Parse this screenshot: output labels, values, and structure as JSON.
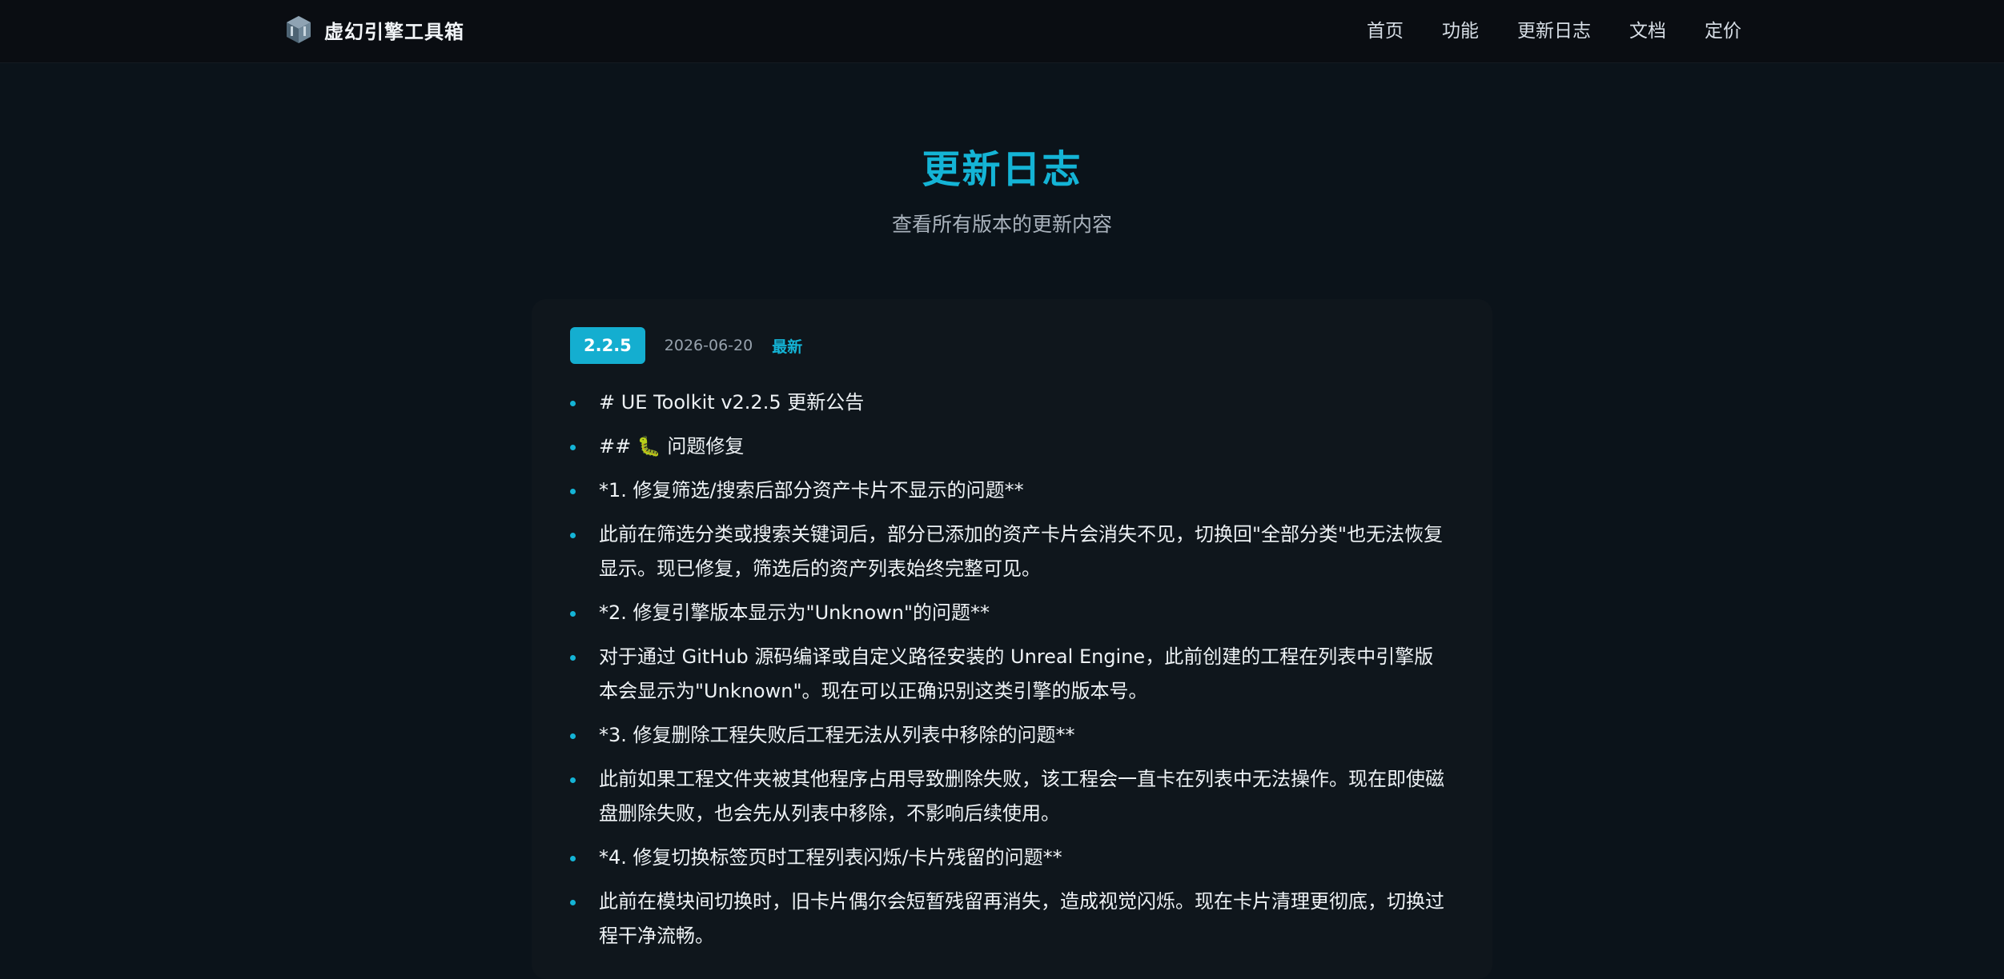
{
  "header": {
    "brand_name": "虚幻引擎工具箱",
    "logo_icon": "unreal-cube-icon",
    "nav": [
      {
        "label": "首页"
      },
      {
        "label": "功能"
      },
      {
        "label": "更新日志"
      },
      {
        "label": "文档"
      },
      {
        "label": "定价"
      }
    ]
  },
  "hero": {
    "title": "更新日志",
    "subtitle": "查看所有版本的更新内容"
  },
  "release": {
    "version": "2.2.5",
    "date": "2026-06-20",
    "tag": "最新",
    "notes": [
      "# UE Toolkit v2.2.5 更新公告",
      "## 🐛 问题修复",
      "*1. 修复筛选/搜索后部分资产卡片不显示的问题**",
      "此前在筛选分类或搜索关键词后，部分已添加的资产卡片会消失不见，切换回\"全部分类\"也无法恢复显示。现已修复，筛选后的资产列表始终完整可见。",
      "*2. 修复引擎版本显示为\"Unknown\"的问题**",
      "对于通过 GitHub 源码编译或自定义路径安装的 Unreal Engine，此前创建的工程在列表中引擎版本会显示为\"Unknown\"。现在可以正确识别这类引擎的版本号。",
      "*3. 修复删除工程失败后工程无法从列表中移除的问题**",
      "此前如果工程文件夹被其他程序占用导致删除失败，该工程会一直卡在列表中无法操作。现在即使磁盘删除失败，也会先从列表中移除，不影响后续使用。",
      "*4. 修复切换标签页时工程列表闪烁/卡片残留的问题**",
      "此前在模块间切换时，旧卡片偶尔会短暂残留再消失，造成视觉闪烁。现在卡片清理更彻底，切换过程干净流畅。"
    ]
  },
  "colors": {
    "accent": "#14b4d6",
    "background": "#0b131a",
    "topbar": "#0a0d12",
    "card": "#0f161c"
  }
}
